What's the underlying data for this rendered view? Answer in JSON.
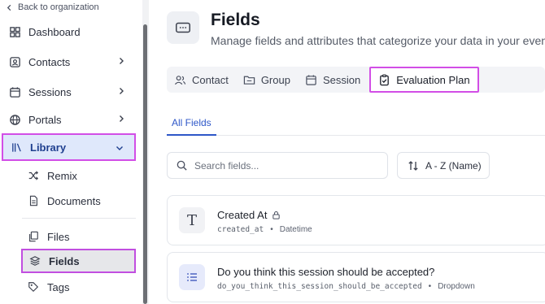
{
  "sidebar": {
    "back_label": "Back to organization",
    "items": [
      {
        "label": "Dashboard",
        "icon": "dashboard-icon"
      },
      {
        "label": "Contacts",
        "icon": "contacts-icon"
      },
      {
        "label": "Sessions",
        "icon": "calendar-icon"
      },
      {
        "label": "Portals",
        "icon": "globe-icon"
      },
      {
        "label": "Library",
        "icon": "library-icon"
      }
    ],
    "library_items": [
      {
        "label": "Remix",
        "icon": "shuffle-icon"
      },
      {
        "label": "Documents",
        "icon": "document-icon"
      },
      {
        "label": "Files",
        "icon": "files-icon"
      },
      {
        "label": "Fields",
        "icon": "layers-icon"
      },
      {
        "label": "Tags",
        "icon": "tag-icon"
      }
    ]
  },
  "header": {
    "title": "Fields",
    "subtitle": "Manage fields and attributes that categorize your data in your event"
  },
  "tabs": [
    {
      "label": "Contact",
      "icon": "contact-icon"
    },
    {
      "label": "Group",
      "icon": "group-icon"
    },
    {
      "label": "Session",
      "icon": "calendar-icon"
    },
    {
      "label": "Evaluation Plan",
      "icon": "clipboard-check-icon"
    }
  ],
  "subtabs": {
    "all_fields": "All Fields"
  },
  "search": {
    "placeholder": "Search fields..."
  },
  "sort": {
    "label": "A - Z (Name)"
  },
  "fields": [
    {
      "name": "Created At",
      "key": "created_at",
      "type": "Datetime",
      "locked": true,
      "icon": "text-type-icon"
    },
    {
      "name": "Do you think this session should be accepted?",
      "key": "do_you_think_this_session_should_be_accepted",
      "type": "Dropdown",
      "locked": false,
      "icon": "list-icon"
    }
  ],
  "colors": {
    "accent": "#2e57c8",
    "highlight": "#d24ee6"
  }
}
